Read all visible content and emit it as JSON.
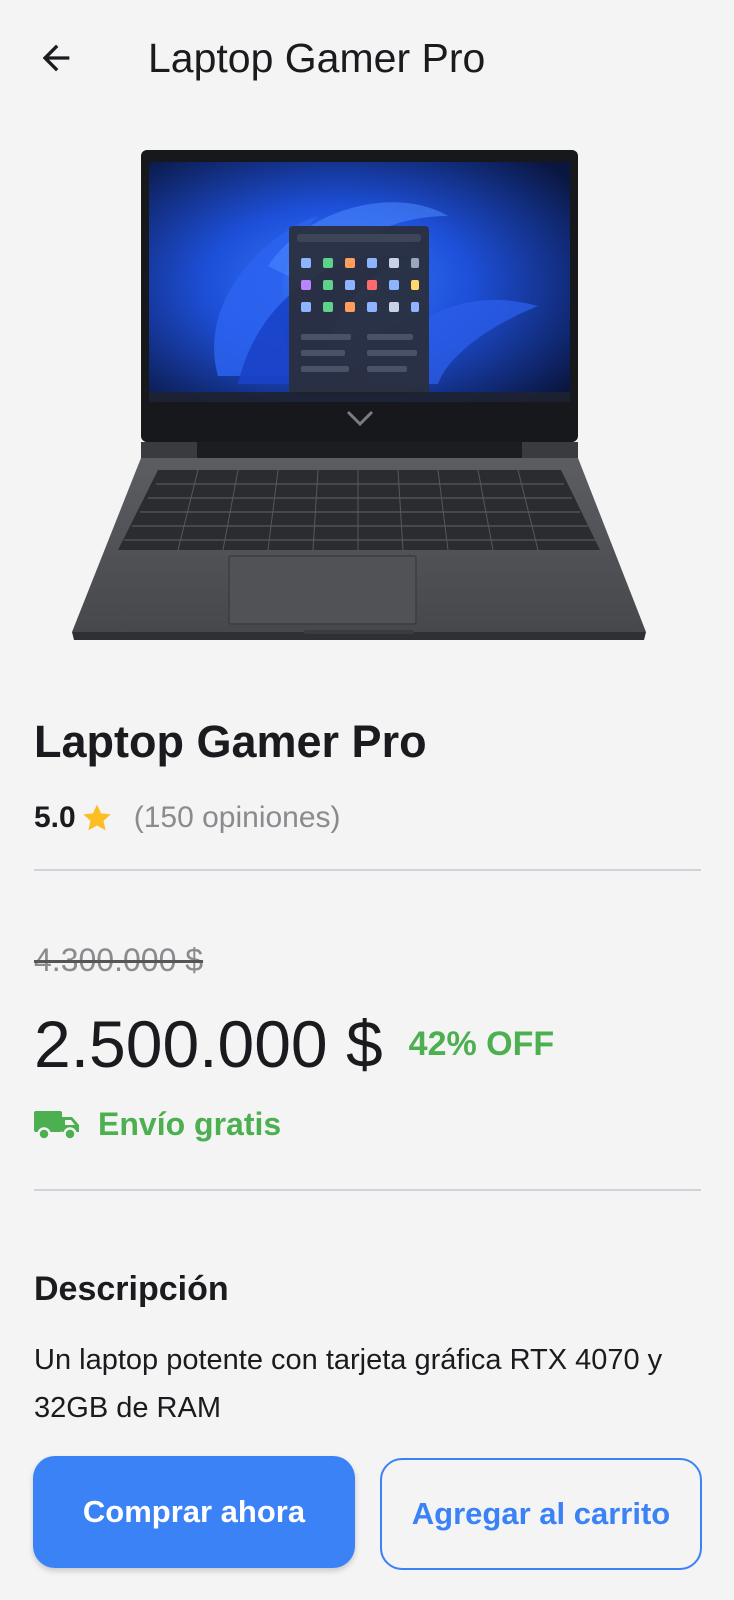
{
  "app_bar": {
    "title": "Laptop Gamer Pro",
    "back_icon": "arrow-back-icon"
  },
  "product": {
    "image_icon": "laptop-image",
    "name": "Laptop Gamer Pro",
    "rating": "5.0",
    "rating_icon": "star-icon",
    "reviews": "(150 opiniones)",
    "old_price": "4.300.000 $",
    "price": "2.500.000 $",
    "discount": "42% OFF",
    "shipping_icon": "truck-icon",
    "shipping": "Envío gratis"
  },
  "description": {
    "title": "Descripción",
    "text": "Un laptop potente con tarjeta gráfica RTX 4070 y 32GB de RAM"
  },
  "actions": {
    "buy": "Comprar ahora",
    "add_to_cart": "Agregar al carrito"
  },
  "colors": {
    "accent": "#3b82f6",
    "success": "#4caf50",
    "star": "#fbbf24",
    "background": "#f4f4f4"
  }
}
